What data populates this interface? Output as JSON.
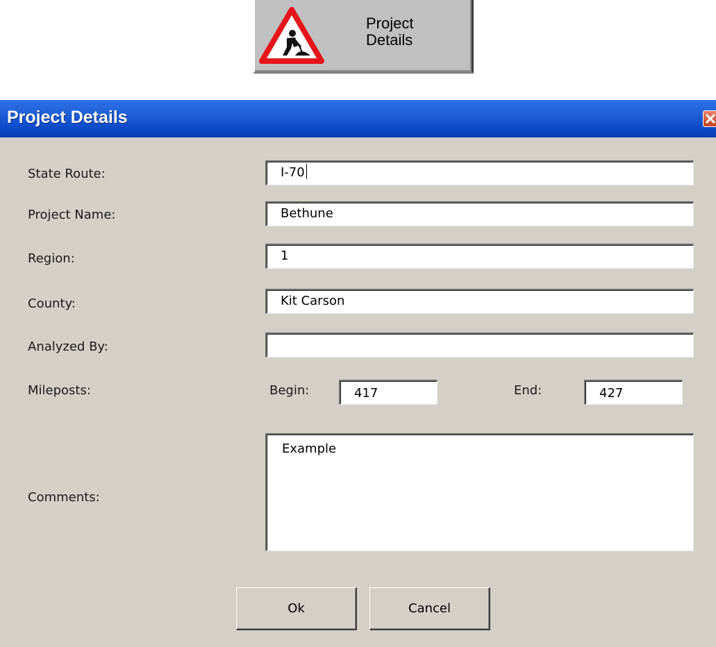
{
  "launcher": {
    "label_line1": "Project",
    "label_line2": "Details",
    "icon": "men-at-work-warning-icon"
  },
  "dialog": {
    "title": "Project Details",
    "close_icon": "close-icon",
    "fields": {
      "state_route": {
        "label": "State Route:",
        "value": "I-70"
      },
      "project_name": {
        "label": "Project Name:",
        "value": "Bethune"
      },
      "region": {
        "label": "Region:",
        "value": "1"
      },
      "county": {
        "label": "County:",
        "value": "Kit Carson"
      },
      "analyzed_by": {
        "label": "Analyzed By:",
        "value": ""
      },
      "mileposts": {
        "label": "Mileposts:",
        "begin_label": "Begin:",
        "begin_value": "417",
        "end_label": "End:",
        "end_value": "427"
      },
      "comments": {
        "label": "Comments:",
        "value": "Example"
      }
    },
    "buttons": {
      "ok": "Ok",
      "cancel": "Cancel"
    }
  },
  "colors": {
    "titlebar": "#0b47c5",
    "dialog_bg": "#d4d0c8",
    "warning_red": "#e5161b"
  }
}
